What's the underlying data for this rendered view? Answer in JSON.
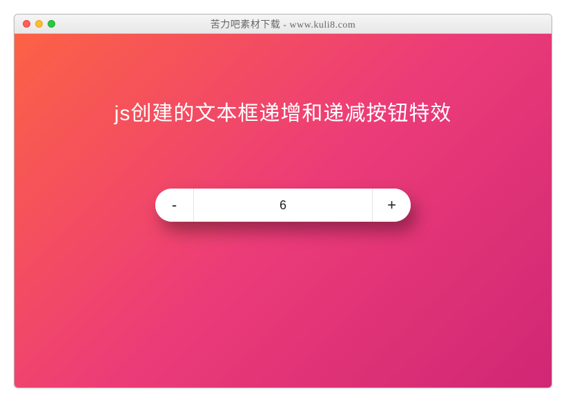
{
  "window": {
    "title": "苦力吧素材下载 - www.kuli8.com"
  },
  "content": {
    "heading": "js创建的文本框递增和递减按钮特效"
  },
  "stepper": {
    "minus_label": "-",
    "plus_label": "+",
    "value": "6"
  }
}
